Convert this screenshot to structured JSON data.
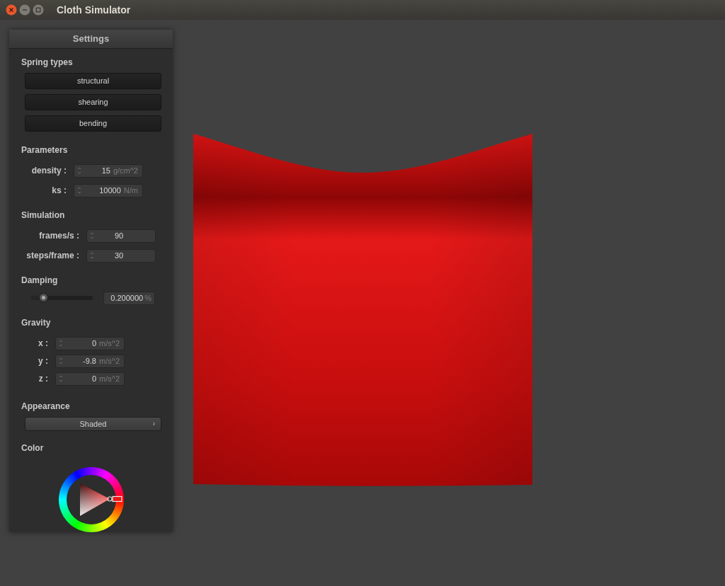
{
  "window": {
    "title": "Cloth Simulator"
  },
  "panel": {
    "title": "Settings"
  },
  "spring_types": {
    "label": "Spring types",
    "buttons": [
      "structural",
      "shearing",
      "bending"
    ]
  },
  "parameters": {
    "label": "Parameters",
    "fields": [
      {
        "label": "density :",
        "value": "15",
        "unit": "g/cm^2"
      },
      {
        "label": "ks :",
        "value": "10000",
        "unit": "N/m"
      }
    ]
  },
  "simulation": {
    "label": "Simulation",
    "fields": [
      {
        "label": "frames/s :",
        "value": "90"
      },
      {
        "label": "steps/frame :",
        "value": "30"
      }
    ]
  },
  "damping": {
    "label": "Damping",
    "level": 0.2,
    "value": "0.200000",
    "unit": "%"
  },
  "gravity": {
    "label": "Gravity",
    "fields": [
      {
        "label": "x :",
        "value": "0",
        "unit": "m/s^2"
      },
      {
        "label": "y :",
        "value": "-9.8",
        "unit": "m/s^2"
      },
      {
        "label": "z :",
        "value": "0",
        "unit": "m/s^2"
      }
    ]
  },
  "appearance": {
    "label": "Appearance",
    "value": "Shaded",
    "arrow": "›"
  },
  "color": {
    "label": "Color"
  }
}
